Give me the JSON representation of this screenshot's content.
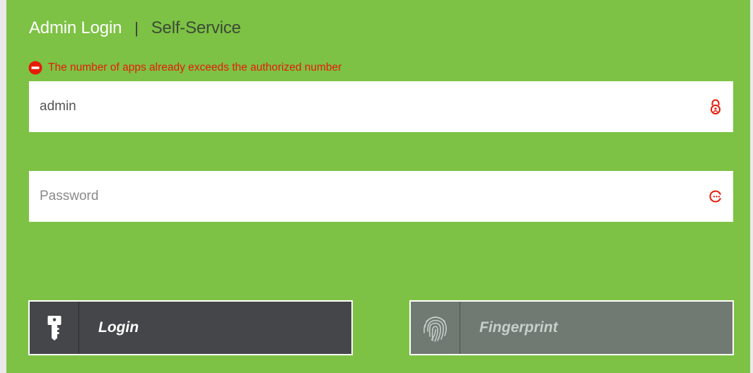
{
  "tabs": {
    "admin_login": "Admin Login",
    "separator": "|",
    "self_service": "Self-Service"
  },
  "error": {
    "message": "The number of apps already exceeds the authorized number",
    "icon": "minus-circle-icon",
    "color": "#e61b0a"
  },
  "username": {
    "value": "admin",
    "placeholder": "",
    "icon": "user-lock-icon"
  },
  "password": {
    "value": "",
    "placeholder": "Password",
    "icon": "password-dots-icon"
  },
  "buttons": {
    "login": {
      "label": "Login",
      "icon": "key-icon"
    },
    "fingerprint": {
      "label": "Fingerprint",
      "icon": "fingerprint-icon"
    }
  },
  "colors": {
    "panel_bg": "#7dc244",
    "login_button_bg": "#454649",
    "fingerprint_button_bg": "#707a73",
    "accent_red": "#e61b0a"
  }
}
